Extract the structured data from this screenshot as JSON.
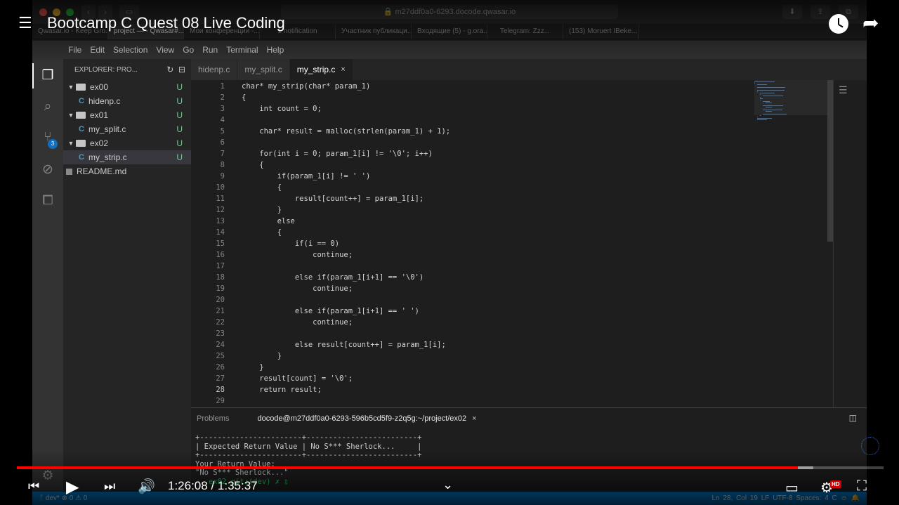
{
  "video": {
    "title": "Bootcamp C Quest 08 Live Coding",
    "time_current": "1:26:08",
    "time_total": "1:35:37",
    "time_display": "1:26:08 / 1:35:37",
    "progress_fraction": 0.901,
    "buffered_fraction": 0.919,
    "quality_badge": "HD",
    "accent": "#ff0000"
  },
  "browser": {
    "url": "m27ddf0a0-6293.docode.qwasar.io",
    "tabs": [
      {
        "label": "Qwasar.io - Keep Gro...",
        "active": false
      },
      {
        "label": "project — - Qwasar#...",
        "active": true
      },
      {
        "label": "Мои конференции -...",
        "active": false
      },
      {
        "label": "1 notification",
        "active": false
      },
      {
        "label": "Участник публикаци...",
        "active": false
      },
      {
        "label": "Входящие (5) - g.ora...",
        "active": false
      },
      {
        "label": "Telegram: Zzz...",
        "active": false
      },
      {
        "label": "(153) Moruert IBeke...",
        "active": false
      }
    ]
  },
  "menu": [
    "File",
    "Edit",
    "Selection",
    "View",
    "Go",
    "Run",
    "Terminal",
    "Help"
  ],
  "explorer": {
    "header": "EXPLORER: PRO...",
    "items": [
      {
        "type": "folder",
        "label": "ex00",
        "status": "U",
        "depth": 0
      },
      {
        "type": "c",
        "label": "hidenp.c",
        "status": "U",
        "depth": 1
      },
      {
        "type": "folder",
        "label": "ex01",
        "status": "U",
        "depth": 0
      },
      {
        "type": "c",
        "label": "my_split.c",
        "status": "U",
        "depth": 1
      },
      {
        "type": "folder",
        "label": "ex02",
        "status": "U",
        "depth": 0
      },
      {
        "type": "c",
        "label": "my_strip.c",
        "status": "U",
        "depth": 1,
        "selected": true
      },
      {
        "type": "md",
        "label": "README.md",
        "status": "",
        "depth": 0
      }
    ]
  },
  "scm_badge": "3",
  "editor_tabs": [
    {
      "label": "hidenp.c",
      "active": false
    },
    {
      "label": "my_split.c",
      "active": false
    },
    {
      "label": "my_strip.c",
      "active": true,
      "close": "×"
    }
  ],
  "code": [
    {
      "n": "1",
      "t": "char* my_strip(char* param_1)"
    },
    {
      "n": "2",
      "t": "{"
    },
    {
      "n": "3",
      "t": "    int count = 0;"
    },
    {
      "n": "4",
      "t": ""
    },
    {
      "n": "5",
      "t": "    char* result = malloc(strlen(param_1) + 1);"
    },
    {
      "n": "6",
      "t": ""
    },
    {
      "n": "7",
      "t": "    for(int i = 0; param_1[i] != '\\0'; i++)"
    },
    {
      "n": "8",
      "t": "    {"
    },
    {
      "n": "9",
      "t": "        if(param_1[i] != ' ')"
    },
    {
      "n": "10",
      "t": "        {"
    },
    {
      "n": "11",
      "t": "            result[count++] = param_1[i];"
    },
    {
      "n": "12",
      "t": "        }"
    },
    {
      "n": "13",
      "t": "        else"
    },
    {
      "n": "14",
      "t": "        {"
    },
    {
      "n": "15",
      "t": "            if(i == 0)"
    },
    {
      "n": "16",
      "t": "                continue;"
    },
    {
      "n": "17",
      "t": ""
    },
    {
      "n": "18",
      "t": "            else if(param_1[i+1] == '\\0')"
    },
    {
      "n": "19",
      "t": "                continue;"
    },
    {
      "n": "20",
      "t": ""
    },
    {
      "n": "21",
      "t": "            else if(param_1[i+1] == ' ')"
    },
    {
      "n": "22",
      "t": "                continue;"
    },
    {
      "n": "23",
      "t": ""
    },
    {
      "n": "24",
      "t": "            else result[count++] = param_1[i];"
    },
    {
      "n": "25",
      "t": "        }"
    },
    {
      "n": "26",
      "t": "    }"
    },
    {
      "n": "27",
      "t": "    result[count] = '\\0';"
    },
    {
      "n": "28",
      "t": "    return result;"
    },
    {
      "n": "29",
      "t": ""
    }
  ],
  "panel": {
    "tabs": [
      {
        "label": "Problems",
        "active": false
      },
      {
        "label": "docode@m27ddf0a0-6293-596b5cd5f9-z2q5g:~/project/ex02",
        "active": true,
        "close": "×"
      }
    ],
    "terminal": [
      "+-----------------------+-------------------------+",
      "| Expected Return Value | No S*** Sherlock...     |",
      "+-----------------------+-------------------------+",
      "Your Return Value:",
      "\"No S*** Sherlock...\"",
      "→  ex02 git:(dev) ✗ ▯"
    ]
  },
  "statusbar": {
    "left": "ᚴ dev*   ⊗ 0 ⚠ 0",
    "right": "Ln 28, Col 19   LF   UTF-8   Spaces: 4   C   ☺   🔔"
  }
}
